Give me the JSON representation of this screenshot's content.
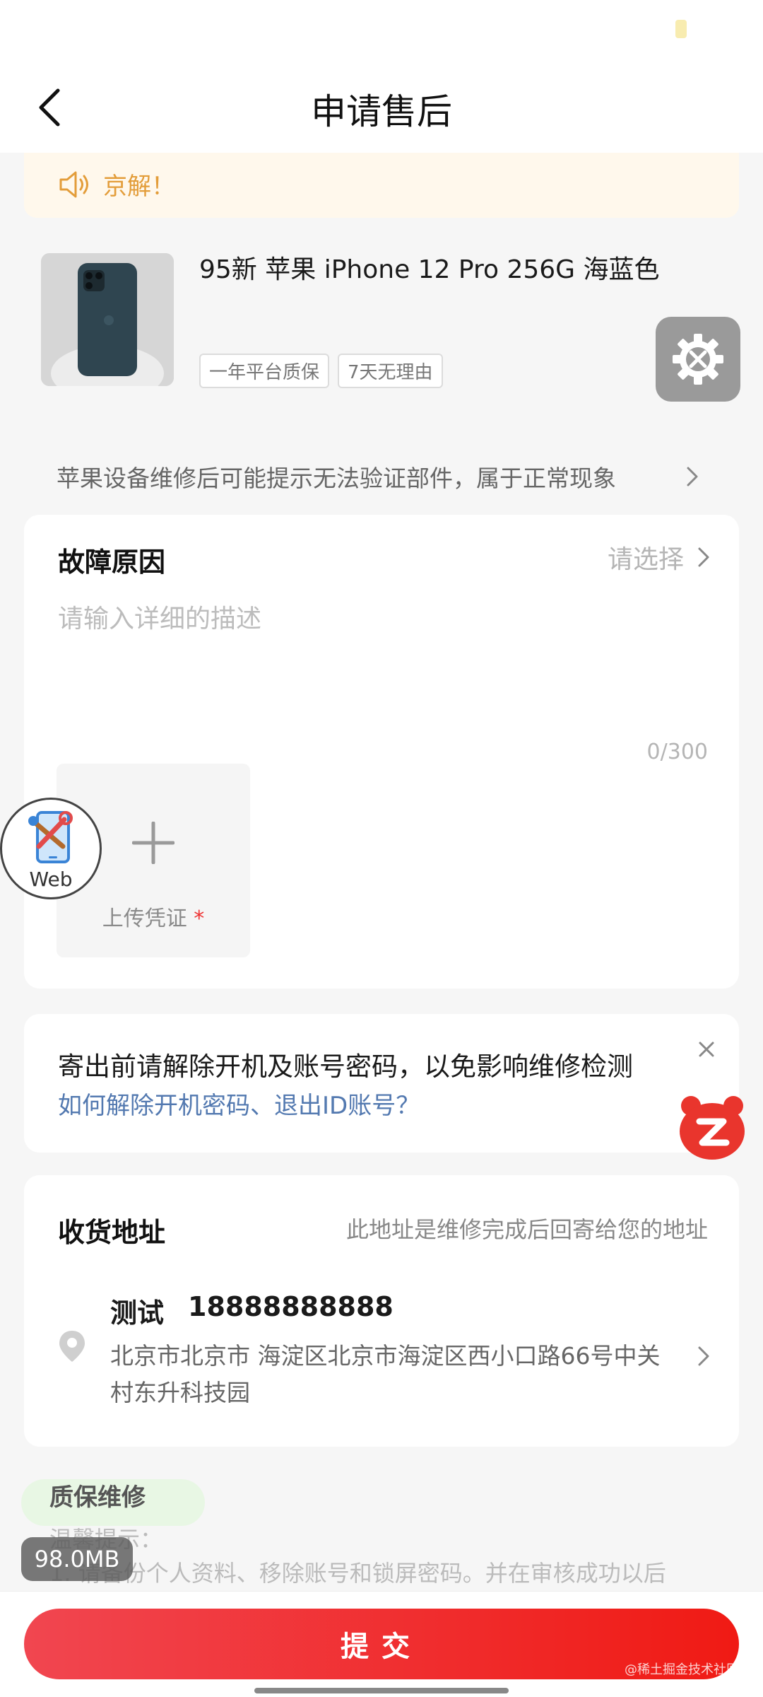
{
  "header": {
    "title": "申请售后"
  },
  "notice": {
    "text": "京解！"
  },
  "product": {
    "title": "95新 苹果 iPhone 12 Pro 256G 海蓝色",
    "tags": [
      "一年平台质保",
      "7天无理由"
    ]
  },
  "tip": {
    "text": "苹果设备维修后可能提示无法验证部件，属于正常现象"
  },
  "fault": {
    "title": "故障原因",
    "select_placeholder": "请选择",
    "desc_placeholder": "请输入详细的描述",
    "counter": "0/300",
    "upload_label": "上传凭证",
    "upload_required": "*"
  },
  "floating": {
    "web_label": "Web",
    "memory": "98.0MB"
  },
  "password_notice": {
    "text": "寄出前请解除开机及账号密码，以免影响维修检测",
    "link": "如何解除开机密码、退出ID账号？"
  },
  "address": {
    "title": "收货地址",
    "note": "此地址是维修完成后回寄给您的地址",
    "name": "测试",
    "phone": "18888888888",
    "detail": "北京市北京市 海淀区北京市海淀区西小口路66号中关村东升科技园"
  },
  "warranty": {
    "title": "质保维修",
    "warm_tip_title": "温馨提示：",
    "warm_tip_text": "1. 请备份个人资料、移除账号和锁屏密码。并在审核成功以后"
  },
  "submit": {
    "label": "提交",
    "watermark": "@稀土掘金技术社区"
  },
  "colors": {
    "accent": "#f01a14",
    "link": "#5379b0",
    "notice": "#e39d3a"
  },
  "icons": [
    "back-arrow-icon",
    "speaker-icon",
    "gear-wrench-icon",
    "chevron-right-icon",
    "plus-icon",
    "phone-tools-icon",
    "close-icon",
    "bear-icon",
    "location-pin-icon"
  ]
}
